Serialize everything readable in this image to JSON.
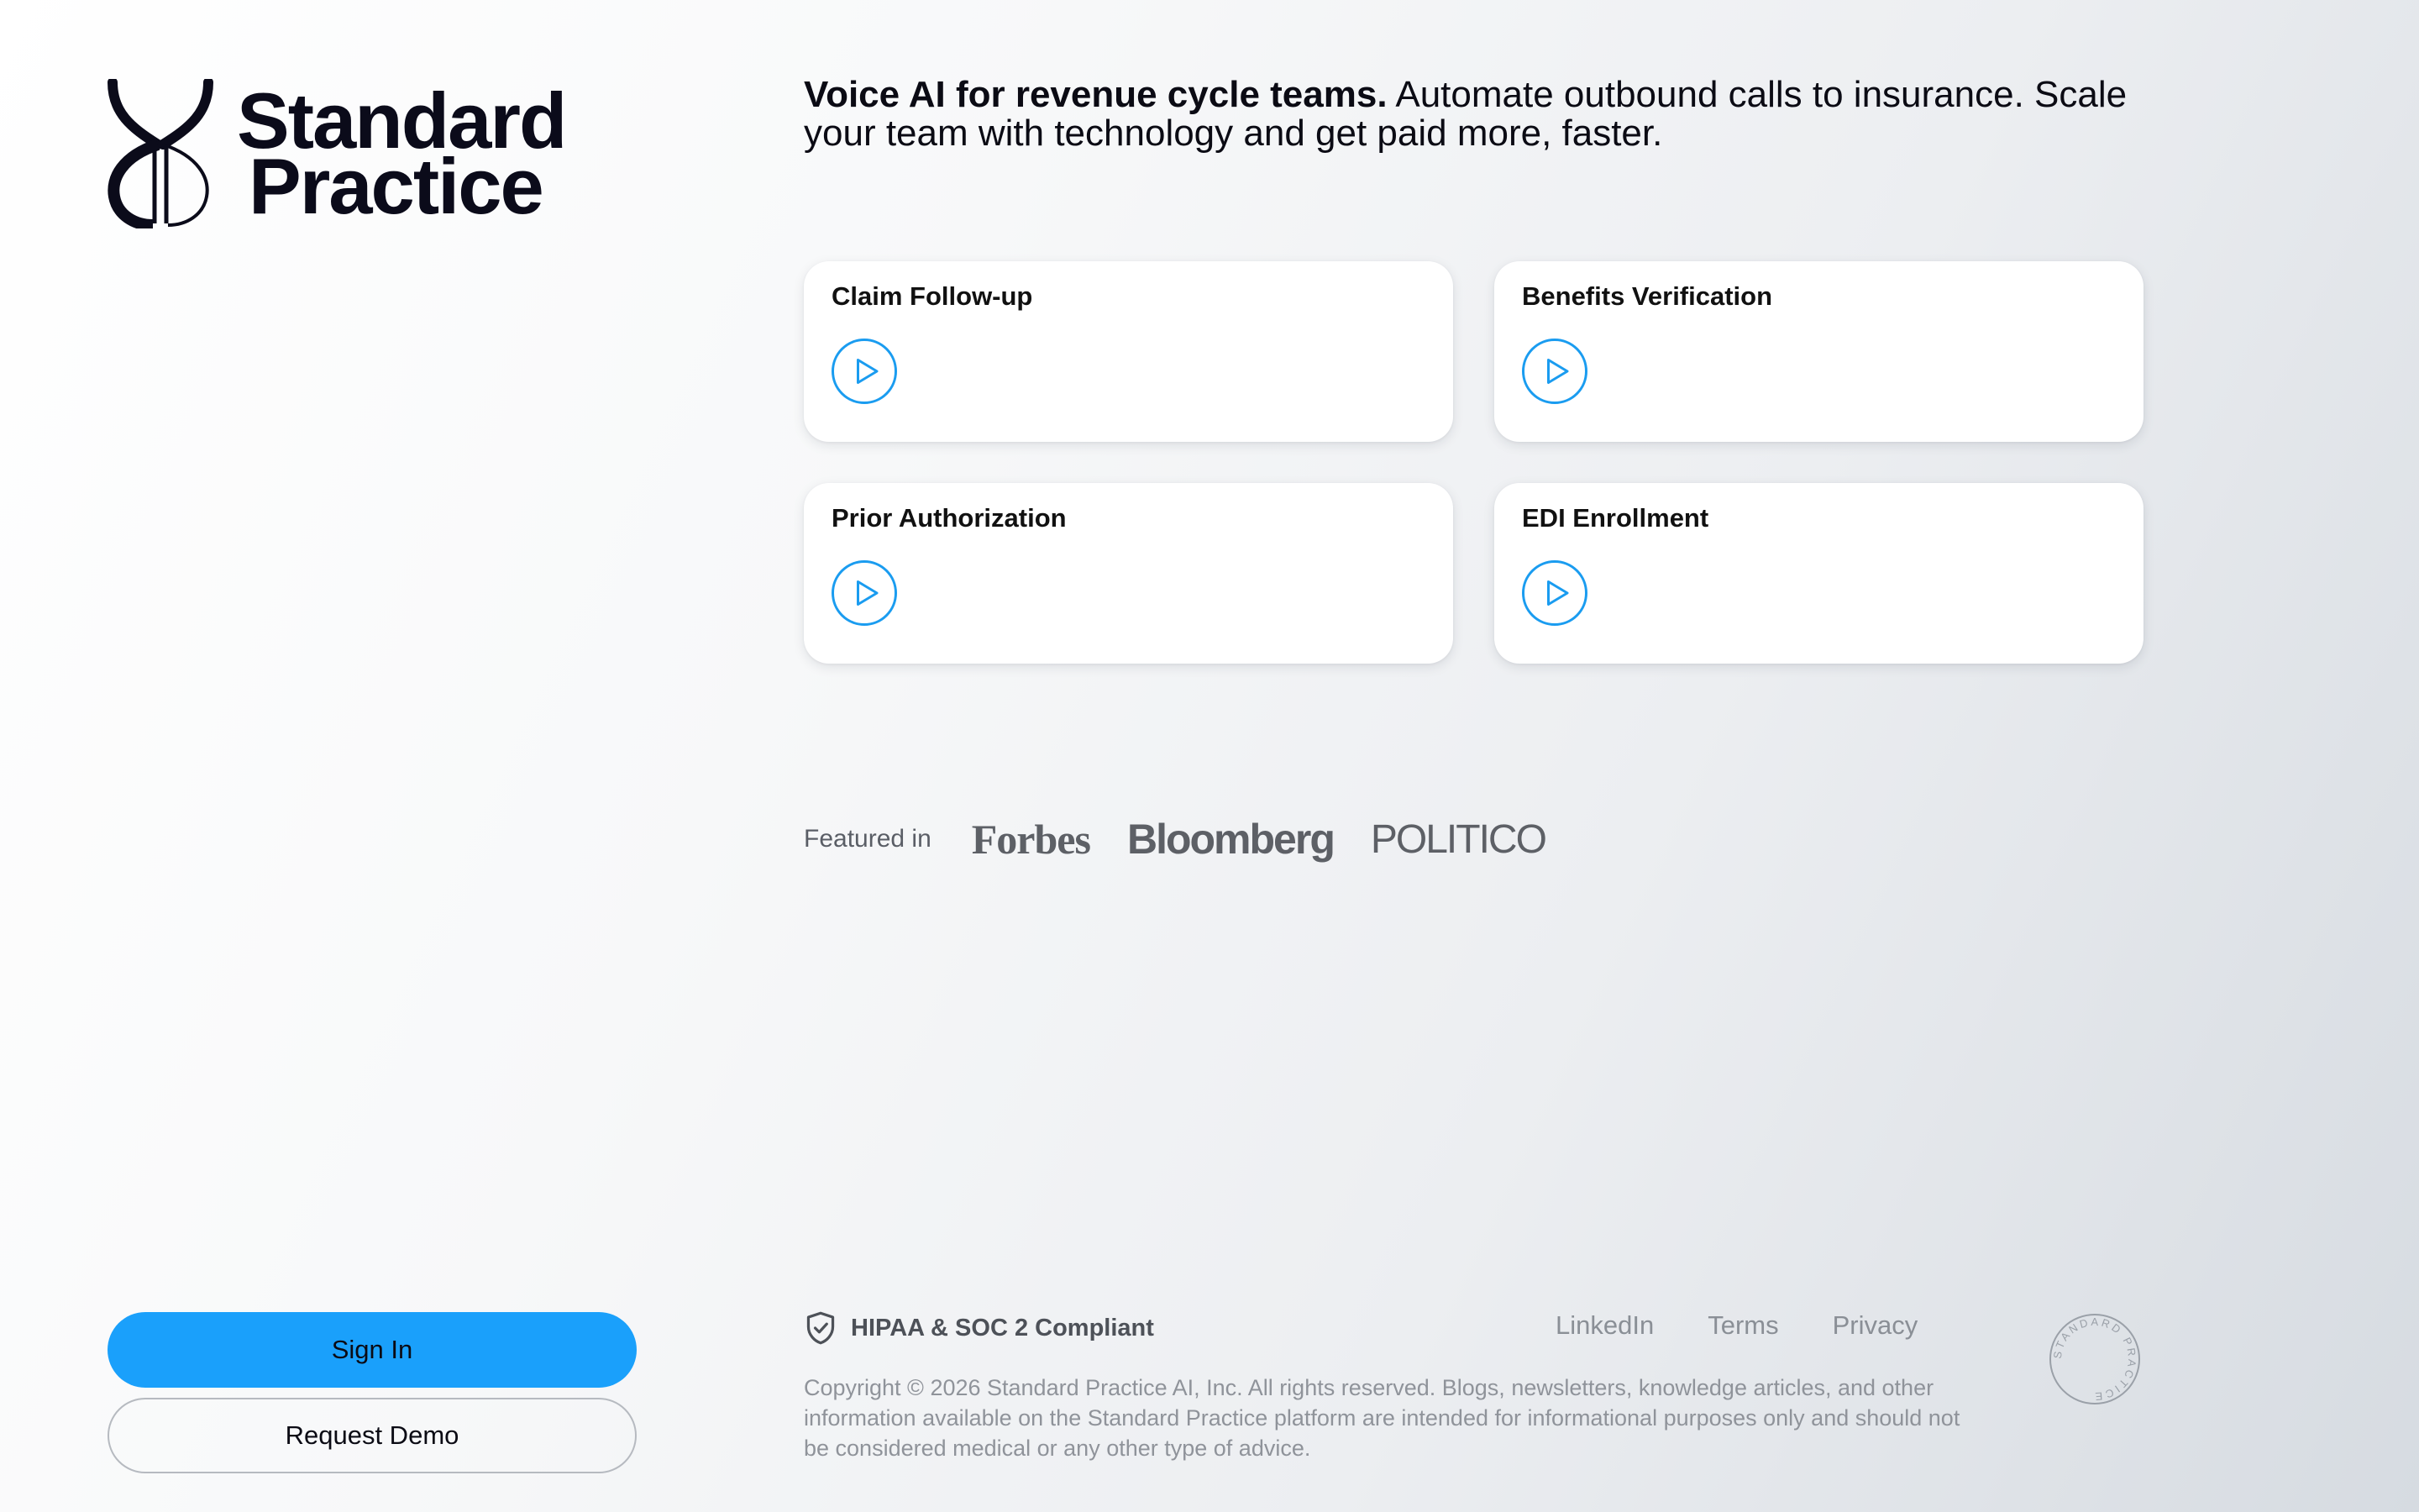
{
  "logo": {
    "line1": "Standard",
    "line2": "Practice",
    "mark_icon": "standard-practice-logo-mark"
  },
  "headline": {
    "bold": "Voice AI for revenue cycle teams.",
    "rest": " Automate outbound calls to insurance. Scale your team with technology and get paid more, faster."
  },
  "cards": [
    {
      "title": "Claim Follow-up",
      "icon": "play-icon"
    },
    {
      "title": "Benefits Verification",
      "icon": "play-icon"
    },
    {
      "title": "Prior Authorization",
      "icon": "play-icon"
    },
    {
      "title": "EDI Enrollment",
      "icon": "play-icon"
    }
  ],
  "featured": {
    "label": "Featured in",
    "outlets": [
      "Forbes",
      "Bloomberg",
      "POLITICO"
    ]
  },
  "auth": {
    "sign_in": "Sign In",
    "request_demo": "Request Demo"
  },
  "footer": {
    "compliance": "HIPAA & SOC 2 Compliant",
    "links": [
      "LinkedIn",
      "Terms",
      "Privacy"
    ],
    "copyright": "Copyright © 2026 Standard Practice AI, Inc. All rights reserved. Blogs, newsletters, knowledge articles, and other information available on the Standard Practice platform are intended for informational purposes only and should not be considered medical or any other type of advice.",
    "seal_text": "STANDARD PRACTICE"
  },
  "colors": {
    "accent": "#1aa0fb",
    "play_stroke": "#1a9cf0",
    "text_dark": "#0b0b14",
    "muted": "#8f939a"
  }
}
